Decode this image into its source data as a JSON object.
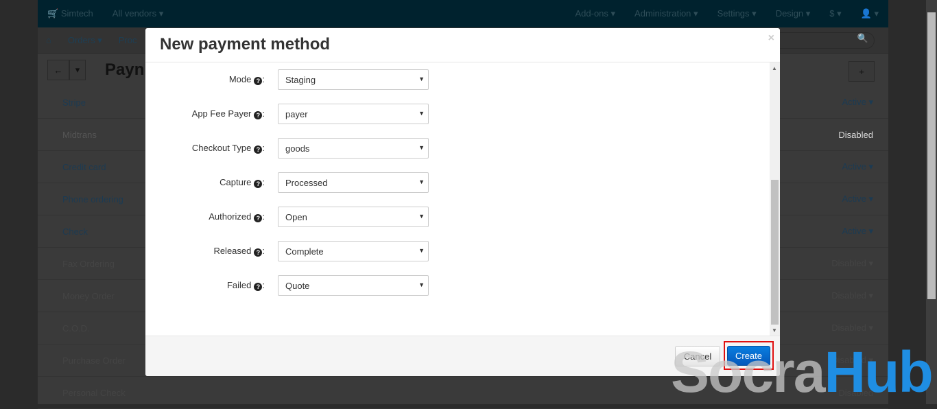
{
  "topnav": {
    "brand": "Simtech",
    "vendor": "All vendors ▾",
    "items": [
      "Add-ons ▾",
      "Administration ▾",
      "Settings ▾",
      "Design ▾",
      "$ ▾",
      "👤 ▾"
    ]
  },
  "subnav": {
    "items": [
      "Orders ▾",
      "Proc"
    ]
  },
  "page": {
    "title": "Payn"
  },
  "methods": [
    {
      "name": "Stripe",
      "status": "Active ▾"
    },
    {
      "name": "Midtrans",
      "status": "Disabled"
    },
    {
      "name": "Credit card",
      "status": "Active ▾"
    },
    {
      "name": "Phone ordering",
      "status": "Active ▾"
    },
    {
      "name": "Check",
      "status": "Active ▾"
    },
    {
      "name": "Fax Ordering",
      "status": "Disabled ▾"
    },
    {
      "name": "Money Order",
      "status": "Disabled ▾"
    },
    {
      "name": "C.O.D.",
      "status": "Disabled ▾"
    },
    {
      "name": "Purchase Order",
      "status": "Disabled ▾"
    },
    {
      "name": "Personal Check",
      "status": "Disabled"
    }
  ],
  "modal": {
    "title": "New payment method",
    "fields": [
      {
        "label": "Mode",
        "value": "Staging"
      },
      {
        "label": "App Fee Payer",
        "value": "payer"
      },
      {
        "label": "Checkout Type",
        "value": "goods"
      },
      {
        "label": "Capture",
        "value": "Processed"
      },
      {
        "label": "Authorized",
        "value": "Open"
      },
      {
        "label": "Released",
        "value": "Complete"
      },
      {
        "label": "Failed",
        "value": "Quote"
      }
    ],
    "cancel": "Cancel",
    "create": "Create"
  },
  "watermark": {
    "a": "Socra",
    "b": "Hub"
  }
}
